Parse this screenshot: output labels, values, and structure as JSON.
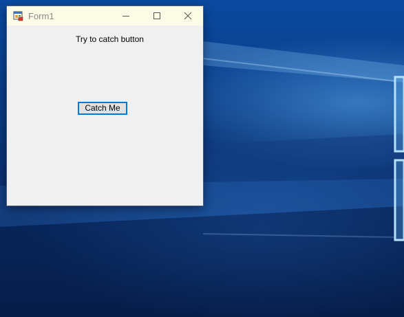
{
  "window": {
    "title": "Form1",
    "controls": {
      "minimize_icon": "minimize-icon",
      "maximize_icon": "maximize-icon",
      "close_icon": "close-icon"
    }
  },
  "form": {
    "label": "Try to catch button",
    "button_label": "Catch Me"
  },
  "colors": {
    "titlebar_bg": "#fbfbe6",
    "client_bg": "#f0f0f0",
    "button_focus_border": "#0078d7",
    "desktop_bg": "#0a3f7c"
  }
}
